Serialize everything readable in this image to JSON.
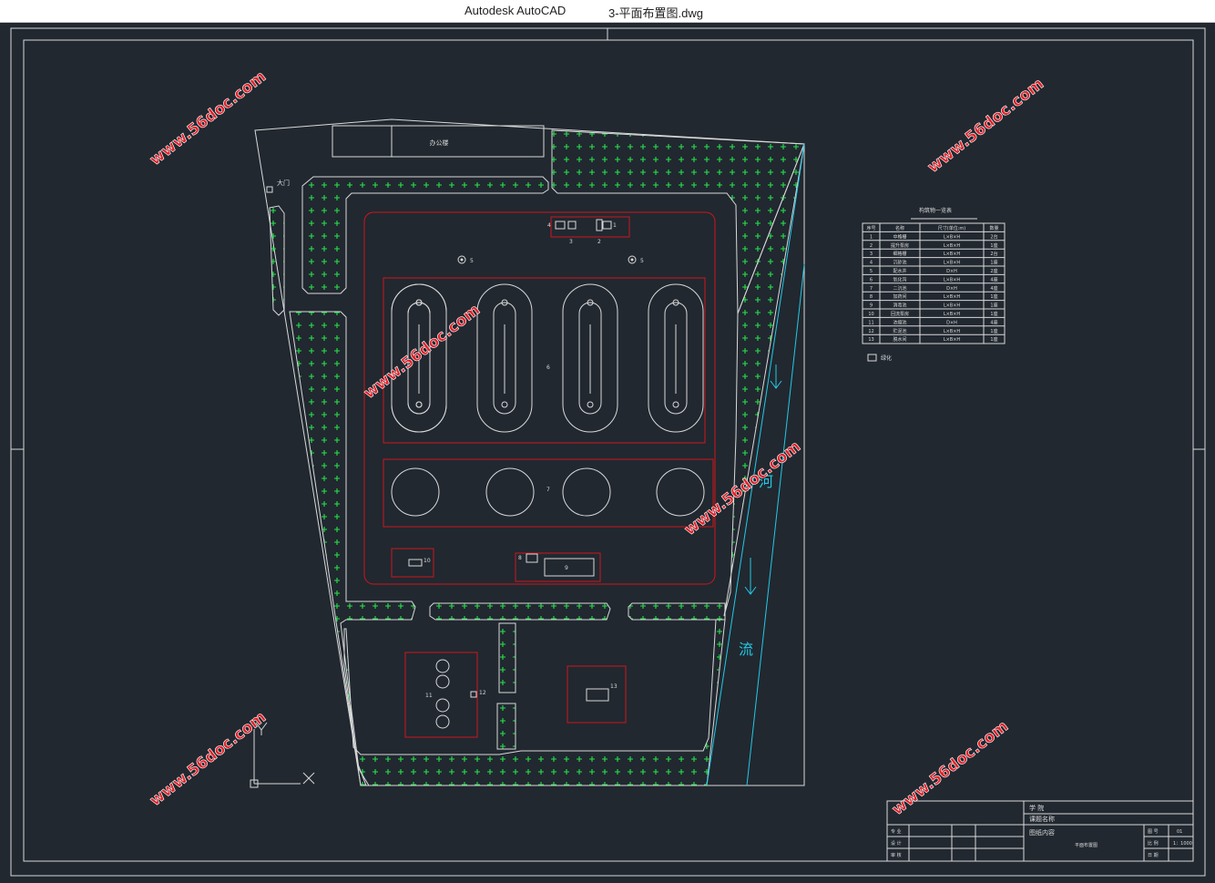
{
  "window": {
    "app_name": "Autodesk AutoCAD",
    "file_name": "3-平面布置图.dwg"
  },
  "colors": {
    "background": "#212830",
    "line": "#d9d9d9",
    "red": "#d0161b",
    "green": "#27e24a",
    "cyan": "#23c9e6",
    "watermark": "#e0222a"
  },
  "watermark": "www.56doc.com",
  "site_labels": {
    "office": "办公楼",
    "gate": "大门",
    "r1": "1",
    "r2": "2",
    "r3": "3",
    "r4": "4",
    "r5a": "5",
    "r5b": "5",
    "r6": "6",
    "r7": "7",
    "r8": "8",
    "r9": "9",
    "r10": "10",
    "r11": "11",
    "r12": "12",
    "r13": "13",
    "river_1": "河",
    "river_2": "流"
  },
  "legend_table": {
    "title": "构筑物一览表",
    "headers": [
      "序号",
      "名称",
      "尺寸(单位:m)",
      "数量"
    ],
    "rows": [
      [
        "1",
        "中格栅",
        "L×B×H",
        "2台"
      ],
      [
        "2",
        "提升泵房",
        "L×B×H",
        "1座"
      ],
      [
        "3",
        "细格栅",
        "L×B×H",
        "2台"
      ],
      [
        "4",
        "沉砂池",
        "L×B×H",
        "1座"
      ],
      [
        "5",
        "配水井",
        "D×H",
        "2座"
      ],
      [
        "6",
        "氧化沟",
        "L×B×H",
        "4座"
      ],
      [
        "7",
        "二沉池",
        "D×H",
        "4座"
      ],
      [
        "8",
        "加药间",
        "L×B×H",
        "1座"
      ],
      [
        "9",
        "消毒池",
        "L×B×H",
        "1座"
      ],
      [
        "10",
        "回流泵房",
        "L×B×H",
        "1座"
      ],
      [
        "11",
        "浓缩池",
        "D×H",
        "4座"
      ],
      [
        "12",
        "贮泥池",
        "L×B×H",
        "1座"
      ],
      [
        "13",
        "脱水间",
        "L×B×H",
        "1座"
      ]
    ],
    "legend_label": "绿化"
  },
  "title_block": {
    "school_label": "学  院",
    "project_label": "课题名称",
    "drawing_label": "图纸内容",
    "drawing_name": "平面布置图",
    "scale_label": "比 例",
    "scale_value": "1：1000",
    "sheet_label": "图 号",
    "sheet_value": "01",
    "date_label": "日 期",
    "major_label": "专 业",
    "design_label": "设 计",
    "check_label": "审 核"
  }
}
